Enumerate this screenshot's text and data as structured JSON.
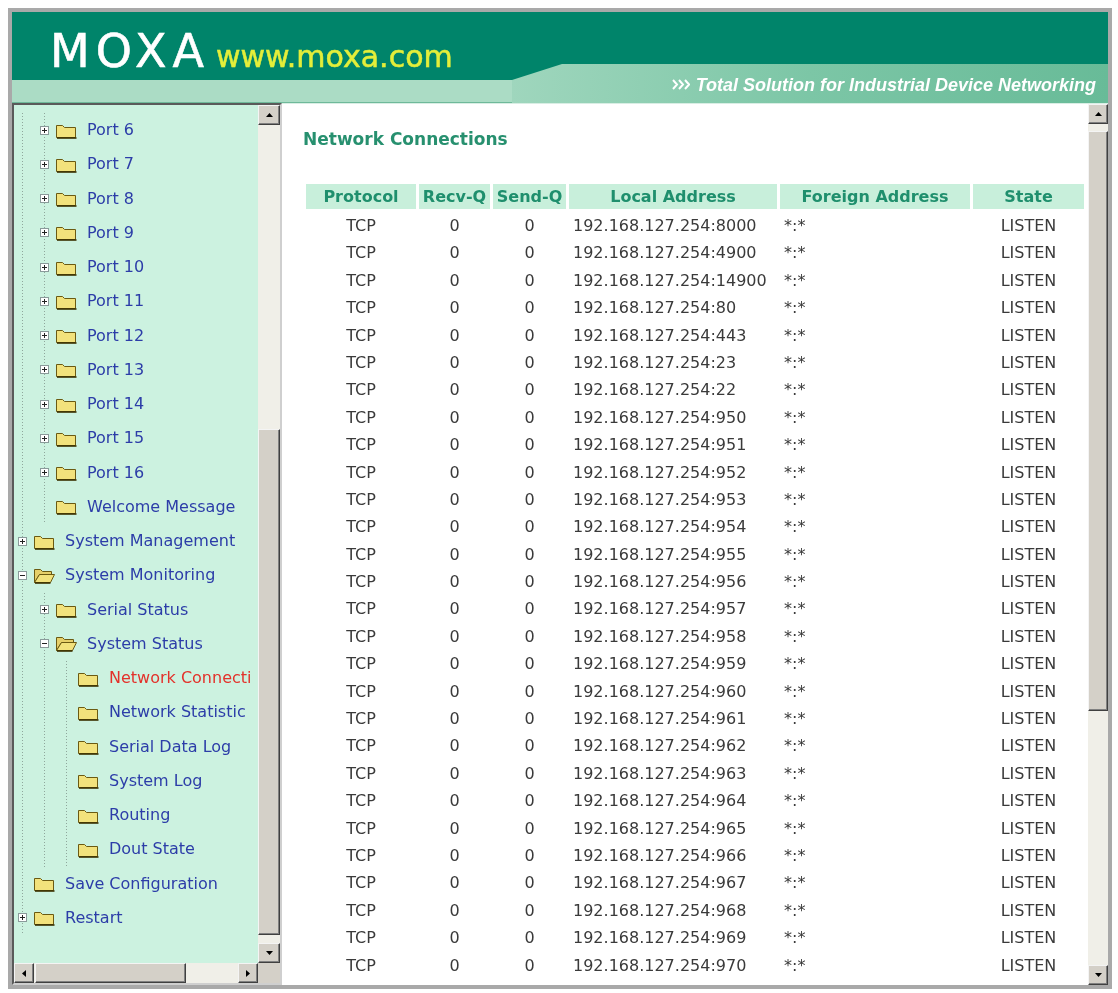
{
  "header": {
    "logo": "MOXA",
    "website": "www.moxa.com",
    "tagline": "Total Solution for Industrial Device Networking"
  },
  "sidebar": {
    "tree": [
      {
        "children": [
          {
            "label": "Port 6",
            "kind": "branch",
            "expanded": false,
            "selected": false
          },
          {
            "label": "Port 7",
            "kind": "branch",
            "expanded": false,
            "selected": false
          },
          {
            "label": "Port 8",
            "kind": "branch",
            "expanded": false,
            "selected": false
          },
          {
            "label": "Port 9",
            "kind": "branch",
            "expanded": false,
            "selected": false
          },
          {
            "label": "Port 10",
            "kind": "branch",
            "expanded": false,
            "selected": false
          },
          {
            "label": "Port 11",
            "kind": "branch",
            "expanded": false,
            "selected": false
          },
          {
            "label": "Port 12",
            "kind": "branch",
            "expanded": false,
            "selected": false
          },
          {
            "label": "Port 13",
            "kind": "branch",
            "expanded": false,
            "selected": false
          },
          {
            "label": "Port 14",
            "kind": "branch",
            "expanded": false,
            "selected": false
          },
          {
            "label": "Port 15",
            "kind": "branch",
            "expanded": false,
            "selected": false
          },
          {
            "label": "Port 16",
            "kind": "branch",
            "expanded": false,
            "selected": false
          },
          {
            "label": "Welcome Message",
            "kind": "leaf",
            "selected": false
          }
        ]
      },
      {
        "label": "System Management",
        "kind": "branch",
        "expanded": false,
        "selected": false
      },
      {
        "label": "System Monitoring",
        "kind": "branch",
        "expanded": true,
        "selected": false,
        "children": [
          {
            "label": "Serial Status",
            "kind": "branch",
            "expanded": false,
            "selected": false
          },
          {
            "label": "System Status",
            "kind": "branch",
            "expanded": true,
            "selected": false,
            "children": [
              {
                "label": "Network Connecti",
                "kind": "leaf",
                "selected": true
              },
              {
                "label": "Network Statistic",
                "kind": "leaf",
                "selected": false
              },
              {
                "label": "Serial Data Log",
                "kind": "leaf",
                "selected": false
              },
              {
                "label": "System Log",
                "kind": "leaf",
                "selected": false
              },
              {
                "label": "Routing",
                "kind": "leaf",
                "selected": false
              },
              {
                "label": "Dout State",
                "kind": "leaf",
                "selected": false
              }
            ]
          }
        ]
      },
      {
        "label": "Save Configuration",
        "kind": "leaf",
        "selected": false
      },
      {
        "label": "Restart",
        "kind": "branch",
        "expanded": false,
        "selected": false
      }
    ]
  },
  "main": {
    "title": "Network Connections",
    "table": {
      "columns": [
        "Protocol",
        "Recv-Q",
        "Send-Q",
        "Local Address",
        "Foreign Address",
        "State"
      ],
      "rows": [
        [
          "TCP",
          "0",
          "0",
          "192.168.127.254:8000",
          "*:*",
          "LISTEN"
        ],
        [
          "TCP",
          "0",
          "0",
          "192.168.127.254:4900",
          "*:*",
          "LISTEN"
        ],
        [
          "TCP",
          "0",
          "0",
          "192.168.127.254:14900",
          "*:*",
          "LISTEN"
        ],
        [
          "TCP",
          "0",
          "0",
          "192.168.127.254:80",
          "*:*",
          "LISTEN"
        ],
        [
          "TCP",
          "0",
          "0",
          "192.168.127.254:443",
          "*:*",
          "LISTEN"
        ],
        [
          "TCP",
          "0",
          "0",
          "192.168.127.254:23",
          "*:*",
          "LISTEN"
        ],
        [
          "TCP",
          "0",
          "0",
          "192.168.127.254:22",
          "*:*",
          "LISTEN"
        ],
        [
          "TCP",
          "0",
          "0",
          "192.168.127.254:950",
          "*:*",
          "LISTEN"
        ],
        [
          "TCP",
          "0",
          "0",
          "192.168.127.254:951",
          "*:*",
          "LISTEN"
        ],
        [
          "TCP",
          "0",
          "0",
          "192.168.127.254:952",
          "*:*",
          "LISTEN"
        ],
        [
          "TCP",
          "0",
          "0",
          "192.168.127.254:953",
          "*:*",
          "LISTEN"
        ],
        [
          "TCP",
          "0",
          "0",
          "192.168.127.254:954",
          "*:*",
          "LISTEN"
        ],
        [
          "TCP",
          "0",
          "0",
          "192.168.127.254:955",
          "*:*",
          "LISTEN"
        ],
        [
          "TCP",
          "0",
          "0",
          "192.168.127.254:956",
          "*:*",
          "LISTEN"
        ],
        [
          "TCP",
          "0",
          "0",
          "192.168.127.254:957",
          "*:*",
          "LISTEN"
        ],
        [
          "TCP",
          "0",
          "0",
          "192.168.127.254:958",
          "*:*",
          "LISTEN"
        ],
        [
          "TCP",
          "0",
          "0",
          "192.168.127.254:959",
          "*:*",
          "LISTEN"
        ],
        [
          "TCP",
          "0",
          "0",
          "192.168.127.254:960",
          "*:*",
          "LISTEN"
        ],
        [
          "TCP",
          "0",
          "0",
          "192.168.127.254:961",
          "*:*",
          "LISTEN"
        ],
        [
          "TCP",
          "0",
          "0",
          "192.168.127.254:962",
          "*:*",
          "LISTEN"
        ],
        [
          "TCP",
          "0",
          "0",
          "192.168.127.254:963",
          "*:*",
          "LISTEN"
        ],
        [
          "TCP",
          "0",
          "0",
          "192.168.127.254:964",
          "*:*",
          "LISTEN"
        ],
        [
          "TCP",
          "0",
          "0",
          "192.168.127.254:965",
          "*:*",
          "LISTEN"
        ],
        [
          "TCP",
          "0",
          "0",
          "192.168.127.254:966",
          "*:*",
          "LISTEN"
        ],
        [
          "TCP",
          "0",
          "0",
          "192.168.127.254:967",
          "*:*",
          "LISTEN"
        ],
        [
          "TCP",
          "0",
          "0",
          "192.168.127.254:968",
          "*:*",
          "LISTEN"
        ],
        [
          "TCP",
          "0",
          "0",
          "192.168.127.254:969",
          "*:*",
          "LISTEN"
        ],
        [
          "TCP",
          "0",
          "0",
          "192.168.127.254:970",
          "*:*",
          "LISTEN"
        ]
      ]
    }
  }
}
